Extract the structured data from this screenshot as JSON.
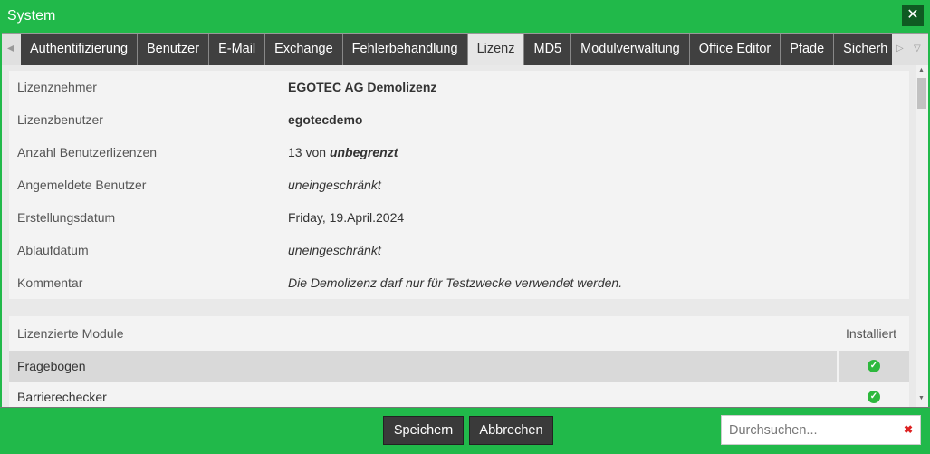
{
  "window": {
    "title": "System",
    "close_icon": "close-icon"
  },
  "tabs": [
    "Authentifizierung",
    "Benutzer",
    "E-Mail",
    "Exchange",
    "Fehlerbehandlung",
    "Lizenz",
    "MD5",
    "Modulverwaltung",
    "Office Editor",
    "Pfade",
    "Sicherh"
  ],
  "active_tab": "Lizenz",
  "license": [
    {
      "label": "Lizenznehmer",
      "value": "EGOTEC AG Demolizenz"
    },
    {
      "label": "Lizenzbenutzer",
      "value": "egotecdemo"
    },
    {
      "label": "Anzahl Benutzerlizenzen",
      "value": "13 von ",
      "value_em": "unbegrenzt"
    },
    {
      "label": "Angemeldete Benutzer",
      "value": "uneingeschränkt"
    },
    {
      "label": "Erstellungsdatum",
      "value": "Friday, 19.April.2024"
    },
    {
      "label": "Ablaufdatum",
      "value": "uneingeschränkt"
    },
    {
      "label": "Kommentar",
      "value": "Die Demolizenz darf nur für Testzwecke verwendet werden."
    }
  ],
  "modules": {
    "header": "Lizenzierte Module",
    "installed_header": "Installiert",
    "rows": [
      {
        "name": "Fragebogen",
        "installed": true
      },
      {
        "name": "Barrierechecker",
        "installed": true
      }
    ]
  },
  "footer": {
    "save": "Speichern",
    "cancel": "Abbrechen",
    "search_placeholder": "Durchsuchen..."
  },
  "colors": {
    "accent": "#21b94a",
    "tab_bg": "#404040"
  }
}
